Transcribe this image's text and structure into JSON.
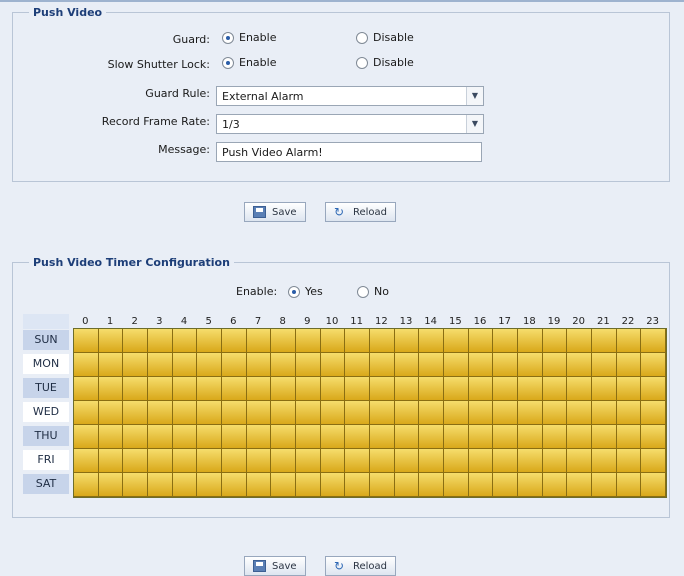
{
  "push_video": {
    "legend": "Push Video",
    "guard": {
      "label": "Guard:",
      "enable": "Enable",
      "disable": "Disable",
      "selected": "enable"
    },
    "slow_shutter_lock": {
      "label": "Slow Shutter Lock:",
      "enable": "Enable",
      "disable": "Disable",
      "selected": "enable"
    },
    "guard_rule": {
      "label": "Guard Rule:",
      "value": "External Alarm"
    },
    "record_frame_rate": {
      "label": "Record Frame Rate:",
      "value": "1/3"
    },
    "message": {
      "label": "Message:",
      "value": "Push Video Alarm!"
    },
    "save_label": "Save",
    "reload_label": "Reload"
  },
  "timer": {
    "legend": "Push Video Timer Configuration",
    "enable": {
      "label": "Enable:",
      "yes": "Yes",
      "no": "No",
      "selected": "yes"
    },
    "hours": [
      "0",
      "1",
      "2",
      "3",
      "4",
      "5",
      "6",
      "7",
      "8",
      "9",
      "10",
      "11",
      "12",
      "13",
      "14",
      "15",
      "16",
      "17",
      "18",
      "19",
      "20",
      "21",
      "22",
      "23"
    ],
    "days": [
      "SUN",
      "MON",
      "TUE",
      "WED",
      "THU",
      "FRI",
      "SAT"
    ],
    "all_hours_selected": true,
    "cell_color": "#e8c232",
    "save_label": "Save",
    "reload_label": "Reload"
  }
}
